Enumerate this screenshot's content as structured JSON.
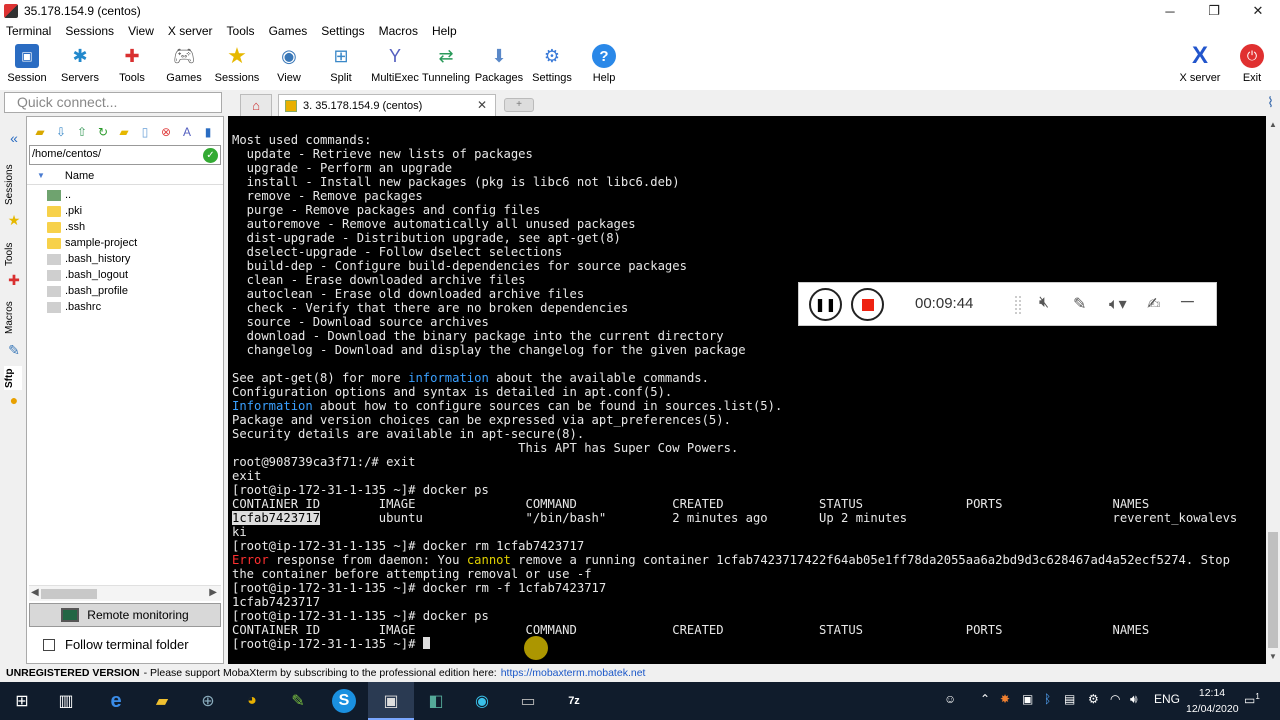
{
  "window": {
    "title": "35.178.154.9 (centos)",
    "minimize": "─",
    "maximize": "❐",
    "close": "✕"
  },
  "menu": [
    "Terminal",
    "Sessions",
    "View",
    "X server",
    "Tools",
    "Games",
    "Settings",
    "Macros",
    "Help"
  ],
  "toolbar": {
    "items": [
      {
        "label": "Session",
        "icon": "session-icon",
        "color": "#2a6cc2"
      },
      {
        "label": "Servers",
        "icon": "servers-icon",
        "color": "#2288cc"
      },
      {
        "label": "Tools",
        "icon": "tools-icon",
        "color": "#d93030"
      },
      {
        "label": "Games",
        "icon": "games-icon",
        "color": "#666666"
      },
      {
        "label": "Sessions",
        "icon": "star-icon",
        "color": "#e6b800"
      },
      {
        "label": "View",
        "icon": "view-icon",
        "color": "#3a78b8"
      },
      {
        "label": "Split",
        "icon": "split-icon",
        "color": "#3a88c8"
      },
      {
        "label": "MultiExec",
        "icon": "multiexec-icon",
        "color": "#5560c0"
      },
      {
        "label": "Tunneling",
        "icon": "tunneling-icon",
        "color": "#2a9a5a"
      },
      {
        "label": "Packages",
        "icon": "packages-icon",
        "color": "#5a88c8"
      },
      {
        "label": "Settings",
        "icon": "settings-icon",
        "color": "#3a7ad8"
      },
      {
        "label": "Help",
        "icon": "help-icon",
        "color": "#2a88e8"
      }
    ],
    "xserver": {
      "label": "X server",
      "icon": "x-server-icon"
    },
    "exit": {
      "label": "Exit",
      "icon": "power-icon"
    }
  },
  "quick_connect": {
    "placeholder": "Quick connect..."
  },
  "tabs": {
    "active_label": "3. 35.178.154.9 (centos)",
    "close": "✕"
  },
  "side_tabs": [
    "Sessions",
    "Tools",
    "Macros",
    "Sftp"
  ],
  "sftp": {
    "path": "/home/centos/",
    "column": "Name",
    "files": [
      {
        "name": "..",
        "type": "up"
      },
      {
        "name": ".pki",
        "type": "folder"
      },
      {
        "name": ".ssh",
        "type": "folder"
      },
      {
        "name": "sample-project",
        "type": "folder"
      },
      {
        "name": ".bash_history",
        "type": "file"
      },
      {
        "name": ".bash_logout",
        "type": "file"
      },
      {
        "name": ".bash_profile",
        "type": "file"
      },
      {
        "name": ".bashrc",
        "type": "file"
      }
    ],
    "remote_monitoring": "Remote monitoring",
    "follow_terminal": "Follow terminal folder"
  },
  "terminal": {
    "lines": [
      [
        {
          "t": "Most used commands:"
        }
      ],
      [
        {
          "t": "  update - Retrieve new lists of packages"
        }
      ],
      [
        {
          "t": "  upgrade - Perform an upgrade"
        }
      ],
      [
        {
          "t": "  install - Install new packages (pkg is libc6 not libc6.deb)"
        }
      ],
      [
        {
          "t": "  remove - Remove packages"
        }
      ],
      [
        {
          "t": "  purge - Remove packages and config files"
        }
      ],
      [
        {
          "t": "  autoremove - Remove automatically all unused packages"
        }
      ],
      [
        {
          "t": "  dist-upgrade - Distribution upgrade, see apt-get(8)"
        }
      ],
      [
        {
          "t": "  dselect-upgrade - Follow dselect selections"
        }
      ],
      [
        {
          "t": "  build-dep - Configure build-dependencies for source packages"
        }
      ],
      [
        {
          "t": "  clean - Erase downloaded archive files"
        }
      ],
      [
        {
          "t": "  autoclean - Erase old downloaded archive files"
        }
      ],
      [
        {
          "t": "  check - Verify that there are no broken dependencies"
        }
      ],
      [
        {
          "t": "  source - Download source archives"
        }
      ],
      [
        {
          "t": "  download - Download the binary package into the current directory"
        }
      ],
      [
        {
          "t": "  changelog - Download and display the changelog for the given package"
        }
      ],
      [
        {
          "t": ""
        }
      ],
      [
        {
          "t": "See apt-get(8) for more "
        },
        {
          "t": "information",
          "c": "blue"
        },
        {
          "t": " about the available commands."
        }
      ],
      [
        {
          "t": "Configuration options and syntax is detailed in apt.conf(5)."
        }
      ],
      [
        {
          "t": "Information",
          "c": "blue"
        },
        {
          "t": " about how to configure sources can be found in sources.list(5)."
        }
      ],
      [
        {
          "t": "Package and version choices can be expressed via apt_preferences(5)."
        }
      ],
      [
        {
          "t": "Security details are available in apt-secure(8)."
        }
      ],
      [
        {
          "t": "                                       This APT has Super Cow Powers."
        }
      ],
      [
        {
          "t": "root@908739ca3f71:/# exit"
        }
      ],
      [
        {
          "t": "exit"
        }
      ],
      [
        {
          "t": "[root@ip-172-31-1-135 ~]# docker ps"
        }
      ],
      [
        {
          "t": "CONTAINER ID        IMAGE               COMMAND             CREATED             STATUS              PORTS               NAMES"
        }
      ],
      [
        {
          "t": "1cfab7423717",
          "c": "hl"
        },
        {
          "t": "        ubuntu              \"/bin/bash\"         2 minutes ago       Up 2 minutes                            reverent_kowalevs"
        }
      ],
      [
        {
          "t": "ki"
        }
      ],
      [
        {
          "t": "[root@ip-172-31-1-135 ~]# docker rm 1cfab7423717"
        }
      ],
      [
        {
          "t": "Error",
          "c": "red"
        },
        {
          "t": " response from daemon: You "
        },
        {
          "t": "cannot",
          "c": "yellow"
        },
        {
          "t": " remove a running container 1cfab7423717422f64ab05e1ff78da2055aa6a2bd9d3c628467ad4a52ecf5274. Stop"
        }
      ],
      [
        {
          "t": "the container before attempting removal or use -f"
        }
      ],
      [
        {
          "t": "[root@ip-172-31-1-135 ~]# docker rm -f 1cfab7423717"
        }
      ],
      [
        {
          "t": "1cfab7423717"
        }
      ],
      [
        {
          "t": "[root@ip-172-31-1-135 ~]# docker ps"
        }
      ],
      [
        {
          "t": "CONTAINER ID        IMAGE               COMMAND             CREATED             STATUS              PORTS               NAMES"
        }
      ],
      [
        {
          "t": "[root@ip-172-31-1-135 ~]# "
        },
        {
          "t": "",
          "c": "cursor"
        }
      ]
    ]
  },
  "recorder": {
    "time": "00:09:44"
  },
  "statusbar": {
    "label": "UNREGISTERED VERSION",
    "message": " -  Please support MobaXterm by subscribing to the professional edition here:",
    "link": "https://mobaxterm.mobatek.net"
  },
  "taskbar": {
    "lang": "ENG",
    "time": "12:14",
    "date": "12/04/2020",
    "notifications": "1"
  },
  "colors": {
    "terminal_bg": "#000000",
    "terminal_fg": "#e8e8e8",
    "error": "#ff3030",
    "info": "#3aa0ff",
    "warn": "#e0d000",
    "link": "#1a57c8"
  }
}
